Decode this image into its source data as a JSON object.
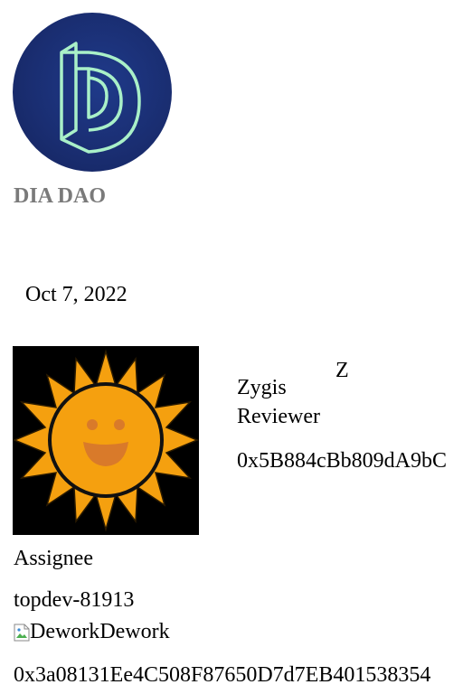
{
  "dao": {
    "name": "DIA DAO",
    "logo_icon": "dao-d-logo-icon",
    "logo_bg_color": "#1a2e72",
    "logo_stroke_color": "#a9f0c8"
  },
  "task": {
    "date": "Oct 7, 2022"
  },
  "reviewer": {
    "initial": "Z",
    "name": "Zygis",
    "role": "Reviewer",
    "address": "0x5B884cBb809dA9bC"
  },
  "assignee": {
    "avatar_icon": "sun-smiley-avatar-icon",
    "label": "Assignee",
    "username": "topdev-81913",
    "address": "0x3a08131Ee4C508F87650D7d7EB401538354"
  },
  "source": {
    "icon_alt": "Dework",
    "label": "Dework"
  }
}
